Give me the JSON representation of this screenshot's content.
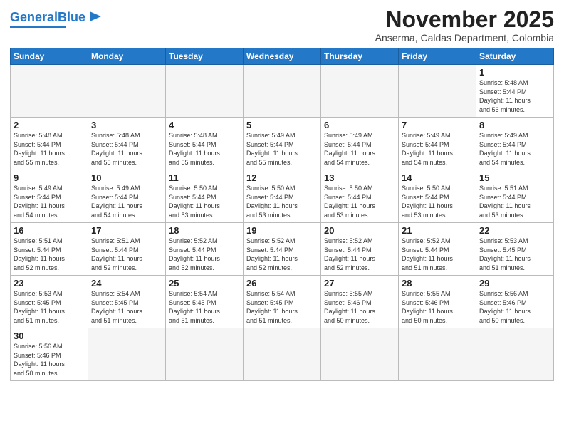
{
  "header": {
    "logo_general": "General",
    "logo_blue": "Blue",
    "month_title": "November 2025",
    "subtitle": "Anserma, Caldas Department, Colombia"
  },
  "days_of_week": [
    "Sunday",
    "Monday",
    "Tuesday",
    "Wednesday",
    "Thursday",
    "Friday",
    "Saturday"
  ],
  "weeks": [
    [
      {
        "day": "",
        "empty": true
      },
      {
        "day": "",
        "empty": true
      },
      {
        "day": "",
        "empty": true
      },
      {
        "day": "",
        "empty": true
      },
      {
        "day": "",
        "empty": true
      },
      {
        "day": "",
        "empty": true
      },
      {
        "day": "1",
        "info": "Sunrise: 5:48 AM\nSunset: 5:44 PM\nDaylight: 11 hours\nand 56 minutes."
      }
    ],
    [
      {
        "day": "2",
        "info": "Sunrise: 5:48 AM\nSunset: 5:44 PM\nDaylight: 11 hours\nand 55 minutes."
      },
      {
        "day": "3",
        "info": "Sunrise: 5:48 AM\nSunset: 5:44 PM\nDaylight: 11 hours\nand 55 minutes."
      },
      {
        "day": "4",
        "info": "Sunrise: 5:48 AM\nSunset: 5:44 PM\nDaylight: 11 hours\nand 55 minutes."
      },
      {
        "day": "5",
        "info": "Sunrise: 5:49 AM\nSunset: 5:44 PM\nDaylight: 11 hours\nand 55 minutes."
      },
      {
        "day": "6",
        "info": "Sunrise: 5:49 AM\nSunset: 5:44 PM\nDaylight: 11 hours\nand 54 minutes."
      },
      {
        "day": "7",
        "info": "Sunrise: 5:49 AM\nSunset: 5:44 PM\nDaylight: 11 hours\nand 54 minutes."
      },
      {
        "day": "8",
        "info": "Sunrise: 5:49 AM\nSunset: 5:44 PM\nDaylight: 11 hours\nand 54 minutes."
      }
    ],
    [
      {
        "day": "9",
        "info": "Sunrise: 5:49 AM\nSunset: 5:44 PM\nDaylight: 11 hours\nand 54 minutes."
      },
      {
        "day": "10",
        "info": "Sunrise: 5:49 AM\nSunset: 5:44 PM\nDaylight: 11 hours\nand 54 minutes."
      },
      {
        "day": "11",
        "info": "Sunrise: 5:50 AM\nSunset: 5:44 PM\nDaylight: 11 hours\nand 53 minutes."
      },
      {
        "day": "12",
        "info": "Sunrise: 5:50 AM\nSunset: 5:44 PM\nDaylight: 11 hours\nand 53 minutes."
      },
      {
        "day": "13",
        "info": "Sunrise: 5:50 AM\nSunset: 5:44 PM\nDaylight: 11 hours\nand 53 minutes."
      },
      {
        "day": "14",
        "info": "Sunrise: 5:50 AM\nSunset: 5:44 PM\nDaylight: 11 hours\nand 53 minutes."
      },
      {
        "day": "15",
        "info": "Sunrise: 5:51 AM\nSunset: 5:44 PM\nDaylight: 11 hours\nand 53 minutes."
      }
    ],
    [
      {
        "day": "16",
        "info": "Sunrise: 5:51 AM\nSunset: 5:44 PM\nDaylight: 11 hours\nand 52 minutes."
      },
      {
        "day": "17",
        "info": "Sunrise: 5:51 AM\nSunset: 5:44 PM\nDaylight: 11 hours\nand 52 minutes."
      },
      {
        "day": "18",
        "info": "Sunrise: 5:52 AM\nSunset: 5:44 PM\nDaylight: 11 hours\nand 52 minutes."
      },
      {
        "day": "19",
        "info": "Sunrise: 5:52 AM\nSunset: 5:44 PM\nDaylight: 11 hours\nand 52 minutes."
      },
      {
        "day": "20",
        "info": "Sunrise: 5:52 AM\nSunset: 5:44 PM\nDaylight: 11 hours\nand 52 minutes."
      },
      {
        "day": "21",
        "info": "Sunrise: 5:52 AM\nSunset: 5:44 PM\nDaylight: 11 hours\nand 51 minutes."
      },
      {
        "day": "22",
        "info": "Sunrise: 5:53 AM\nSunset: 5:45 PM\nDaylight: 11 hours\nand 51 minutes."
      }
    ],
    [
      {
        "day": "23",
        "info": "Sunrise: 5:53 AM\nSunset: 5:45 PM\nDaylight: 11 hours\nand 51 minutes."
      },
      {
        "day": "24",
        "info": "Sunrise: 5:54 AM\nSunset: 5:45 PM\nDaylight: 11 hours\nand 51 minutes."
      },
      {
        "day": "25",
        "info": "Sunrise: 5:54 AM\nSunset: 5:45 PM\nDaylight: 11 hours\nand 51 minutes."
      },
      {
        "day": "26",
        "info": "Sunrise: 5:54 AM\nSunset: 5:45 PM\nDaylight: 11 hours\nand 51 minutes."
      },
      {
        "day": "27",
        "info": "Sunrise: 5:55 AM\nSunset: 5:46 PM\nDaylight: 11 hours\nand 50 minutes."
      },
      {
        "day": "28",
        "info": "Sunrise: 5:55 AM\nSunset: 5:46 PM\nDaylight: 11 hours\nand 50 minutes."
      },
      {
        "day": "29",
        "info": "Sunrise: 5:56 AM\nSunset: 5:46 PM\nDaylight: 11 hours\nand 50 minutes."
      }
    ],
    [
      {
        "day": "30",
        "info": "Sunrise: 5:56 AM\nSunset: 5:46 PM\nDaylight: 11 hours\nand 50 minutes."
      },
      {
        "day": "",
        "empty": true
      },
      {
        "day": "",
        "empty": true
      },
      {
        "day": "",
        "empty": true
      },
      {
        "day": "",
        "empty": true
      },
      {
        "day": "",
        "empty": true
      },
      {
        "day": "",
        "empty": true
      }
    ]
  ]
}
